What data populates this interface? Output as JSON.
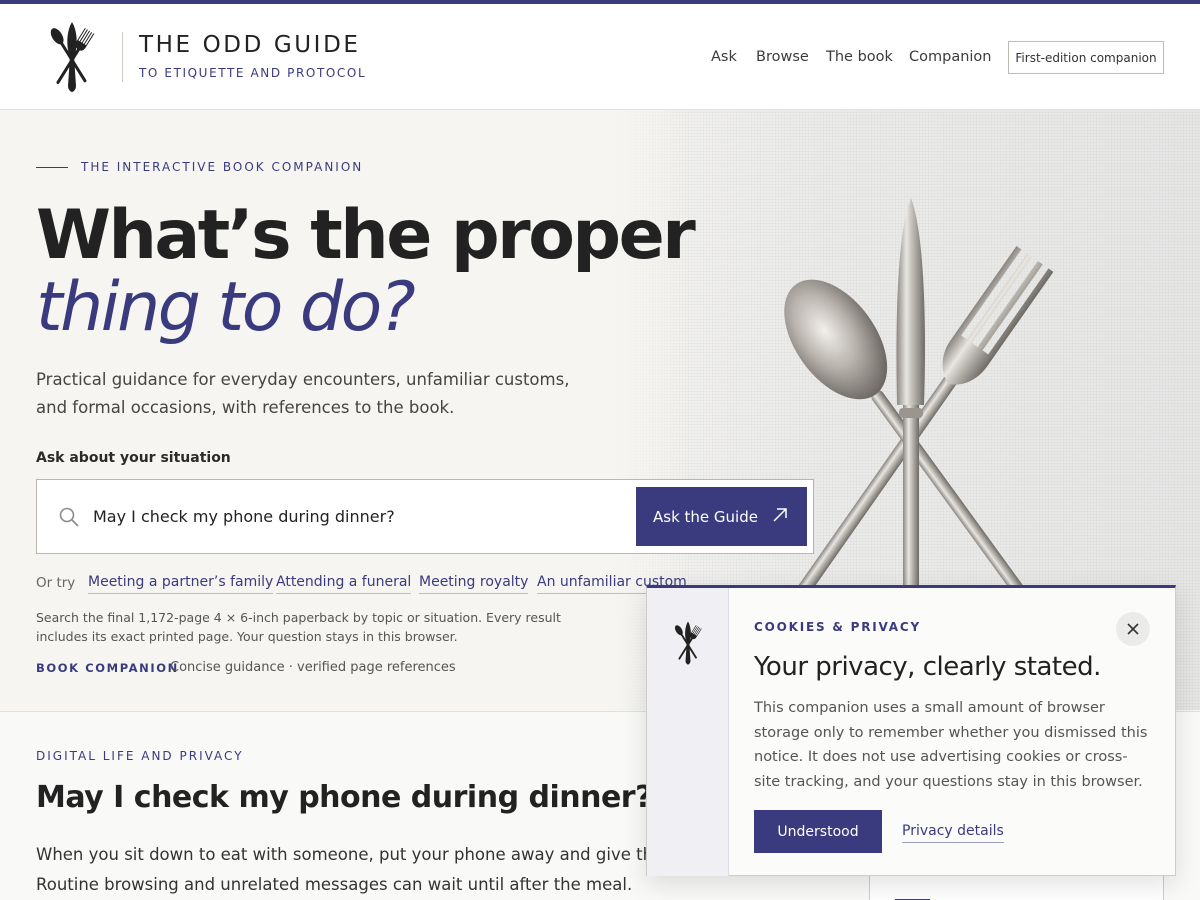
{
  "brand": {
    "title": "THE ODD GUIDE",
    "subtitle": "TO ETIQUETTE AND PROTOCOL",
    "logo_icon": "cutlery-icon"
  },
  "nav": {
    "items": [
      "Ask",
      "Browse",
      "The book",
      "Companion"
    ],
    "edition_button": "First-edition companion"
  },
  "hero": {
    "eyebrow": "THE INTERACTIVE BOOK COMPANION",
    "headline_line1": "What’s the proper",
    "headline_line2": "thing to do?",
    "lead": "Practical guidance for everyday encounters, unfamiliar customs, and formal occasions, with references to the book.",
    "image": "cutlery-photo"
  },
  "search": {
    "label": "Ask about your situation",
    "value": "May I check my phone during dinner?",
    "button": "Ask the Guide",
    "try_label": "Or try",
    "suggestions": [
      "Meeting a partner’s family",
      "Attending a funeral",
      "Meeting royalty",
      "An unfamiliar custom"
    ],
    "note": "Search the final 1,172-page 4 × 6-inch paperback by topic or situation. Every result includes its exact printed page. Your question stays in this browser.",
    "companion_tag": "BOOK COMPANION",
    "companion_desc": "Concise guidance · verified page references"
  },
  "answer": {
    "eyebrow": "DIGITAL LIFE AND PRIVACY",
    "title": "May I check my phone during dinner?",
    "body_line1": "When you sit down to eat with someone, put your phone away and give them",
    "body_line2": "Routine browsing and unrelated messages can wait until after the meal."
  },
  "cookie": {
    "eyebrow": "COOKIES & PRIVACY",
    "title": "Your privacy, clearly stated.",
    "body": "This companion uses a small amount of browser storage only to remember whether you dismissed this notice. It does not use advertising cookies or cross-site tracking, and your questions stay in this browser.",
    "accept": "Understood",
    "details": "Privacy details"
  },
  "colors": {
    "accent": "#3a3b7e",
    "background": "#f6f5f2"
  }
}
